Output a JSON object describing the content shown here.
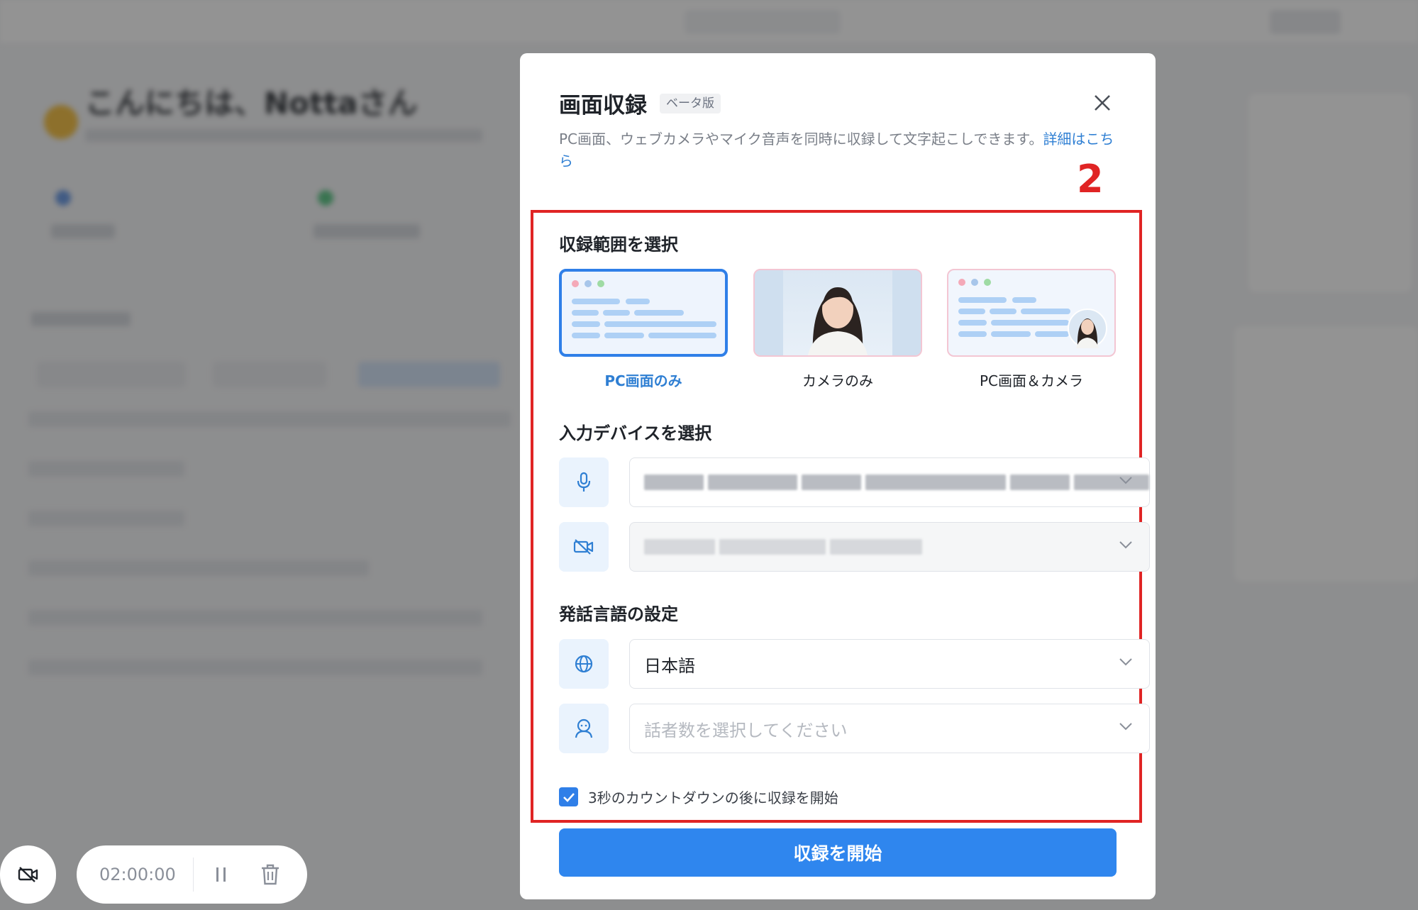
{
  "background": {
    "greeting": "こんにちは、Nottaさん"
  },
  "recorder": {
    "time": "02:00:00",
    "camera_icon": "camera-off-icon",
    "pause_icon": "pause-icon",
    "delete_icon": "trash-icon"
  },
  "modal": {
    "title": "画面収録",
    "badge": "ベータ版",
    "description": "PC画面、ウェブカメラやマイク音声を同時に収録して文字起こしできます。",
    "details_link": "詳細はこちら",
    "step_number": "2",
    "range_section_title": "収録範囲を選択",
    "range_options": [
      {
        "label": "PC画面のみ",
        "selected": true
      },
      {
        "label": "カメラのみ",
        "selected": false
      },
      {
        "label": "PC画面＆カメラ",
        "selected": false
      }
    ],
    "device_section_title": "入力デバイスを選択",
    "devices": {
      "microphone_icon": "microphone-icon",
      "camera_icon": "camera-off-icon"
    },
    "language_section_title": "発話言語の設定",
    "language": {
      "icon": "globe-icon",
      "value": "日本語"
    },
    "speakers": {
      "icon": "user-icon",
      "placeholder": "話者数を選択してください"
    },
    "countdown_checkbox": {
      "label": "3秒のカウントダウンの後に収録を開始",
      "checked": true
    },
    "start_button": "収録を開始",
    "colors": {
      "accent": "#2f86ee",
      "link": "#2f7fd3",
      "highlight": "#e02424"
    }
  }
}
